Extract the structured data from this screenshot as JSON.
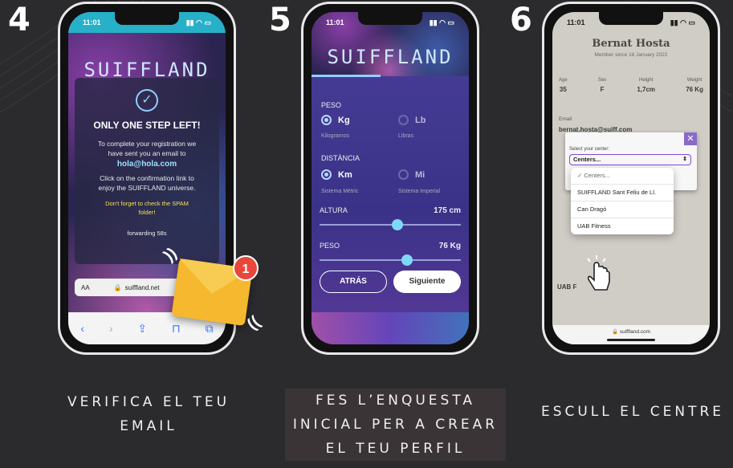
{
  "steps": [
    {
      "num": "4",
      "caption_l1": "VERIFICA EL TEU",
      "caption_l2": "EMAIL"
    },
    {
      "num": "5",
      "caption_l1": "FES L’ENQUESTA",
      "caption_l2": "INICIAL PER A CREAR",
      "caption_l3": "EL TEU PERFIL"
    },
    {
      "num": "6",
      "caption_l1": "ESCULL EL CENTRE"
    }
  ],
  "phone4": {
    "time": "11:01",
    "logo": "SUIFFLAND",
    "check_icon": "check-circle-icon",
    "title": "ONLY ONE STEP LEFT!",
    "line1": "To complete your registration we",
    "line2": "have sent you an email to",
    "email": "hola@hola.com",
    "line3": "Click on the confirmation link to",
    "line4": "enjoy the SUIFFLAND universe.",
    "warn1": "Don't forget to check the SPAM",
    "warn2": "folder!",
    "forwarding": "forwarding 58s",
    "url_aa": "AA",
    "url": "suiffland.net",
    "badge": "1"
  },
  "phone5": {
    "time": "11:01",
    "logo": "SUIFFLAND",
    "peso_label": "PESO",
    "kg": "Kg",
    "kg_sub": "Kilogramos",
    "lb": "Lb",
    "lb_sub": "Libras",
    "dist_label": "DISTÀNCIA",
    "km": "Km",
    "km_sub": "Sistema Mètric",
    "mi": "Mi",
    "mi_sub": "Sistema Imperial",
    "altura_label": "ALTURA",
    "altura_val": "175 cm",
    "altura_fraction": 0.55,
    "peso2_label": "PESO",
    "peso2_val": "76 Kg",
    "peso2_fraction": 0.62,
    "back": "ATRÁS",
    "next": "Siguiente"
  },
  "phone6": {
    "time": "11:01",
    "name": "Bernat Hosta",
    "member": "Member since 18 January 2022",
    "stats": [
      {
        "label": "Age",
        "value": "35"
      },
      {
        "label": "Sex",
        "value": "F"
      },
      {
        "label": "Height",
        "value": "1,7cm"
      },
      {
        "label": "Weight",
        "value": "76 Kg"
      }
    ],
    "email_label": "Email",
    "email": "bernat.hosta@suiff.com",
    "picker_label": "Select your center:",
    "picker_value": "Centers...",
    "options": [
      "✓ Centers...",
      "SUIFFLAND Sant Feliu de Ll.",
      "Can Dragó",
      "UAB Fitness"
    ],
    "partial_text": "UAB F",
    "url": "suiffland.com"
  }
}
